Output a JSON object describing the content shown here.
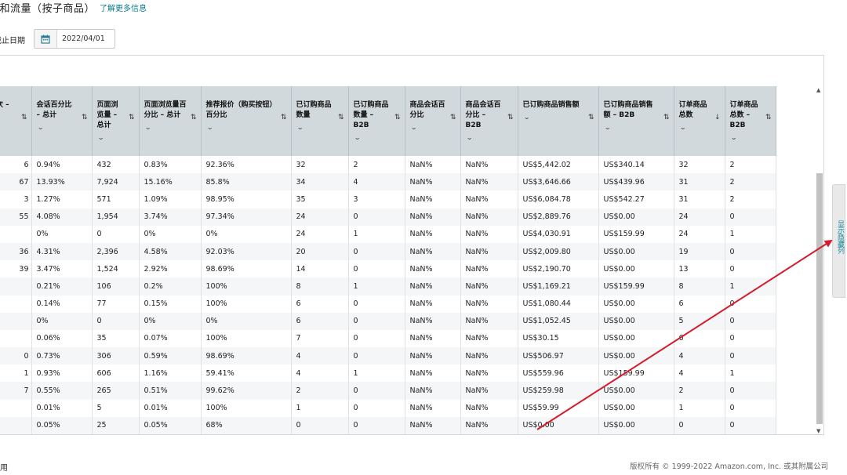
{
  "header": {
    "title": "售和流量（按子商品）",
    "learn_more": "了解更多信息"
  },
  "filter": {
    "date_label": "截止日期",
    "date_value": "2022/04/01"
  },
  "table": {
    "columns": [
      {
        "label": "话次 – 总",
        "sort": "⇅"
      },
      {
        "label": "会话百分比 – 总计",
        "sort": "⇅"
      },
      {
        "label": "页面浏览量 – 总计",
        "sort": "⇅"
      },
      {
        "label": "页面浏览量百分比 – 总计",
        "sort": "⇅"
      },
      {
        "label": "推荐报价（购买按钮）百分比",
        "sort": "⇅"
      },
      {
        "label": "已订购商品数量",
        "sort": "⇅"
      },
      {
        "label": "已订购商品数量 – B2B",
        "sort": "⇅"
      },
      {
        "label": "商品会话百分比",
        "sort": "⇅"
      },
      {
        "label": "商品会话百分比 – B2B",
        "sort": "⇅"
      },
      {
        "label": "已订购商品销售额",
        "sort": "⇅"
      },
      {
        "label": "已订购商品销售额 – B2B",
        "sort": "⇅"
      },
      {
        "label": "订单商品总数",
        "sort": "↓"
      },
      {
        "label": "订单商品总数 – B2B",
        "sort": "⇅"
      }
    ],
    "rows": [
      [
        "6",
        "0.94%",
        "432",
        "0.83%",
        "92.36%",
        "32",
        "2",
        "NaN%",
        "NaN%",
        "US$5,442.02",
        "US$340.14",
        "32",
        "2"
      ],
      [
        "67",
        "13.93%",
        "7,924",
        "15.16%",
        "85.8%",
        "34",
        "4",
        "NaN%",
        "NaN%",
        "US$3,646.66",
        "US$439.96",
        "31",
        "2"
      ],
      [
        "3",
        "1.27%",
        "571",
        "1.09%",
        "98.95%",
        "35",
        "3",
        "NaN%",
        "NaN%",
        "US$6,084.78",
        "US$542.27",
        "31",
        "2"
      ],
      [
        "55",
        "4.08%",
        "1,954",
        "3.74%",
        "97.34%",
        "24",
        "0",
        "NaN%",
        "NaN%",
        "US$2,889.76",
        "US$0.00",
        "24",
        "0"
      ],
      [
        "",
        "0%",
        "0",
        "0%",
        "0%",
        "24",
        "1",
        "NaN%",
        "NaN%",
        "US$4,030.91",
        "US$159.99",
        "24",
        "1"
      ],
      [
        "36",
        "4.31%",
        "2,396",
        "4.58%",
        "92.03%",
        "20",
        "0",
        "NaN%",
        "NaN%",
        "US$2,009.80",
        "US$0.00",
        "19",
        "0"
      ],
      [
        "39",
        "3.47%",
        "1,524",
        "2.92%",
        "98.69%",
        "14",
        "0",
        "NaN%",
        "NaN%",
        "US$2,190.70",
        "US$0.00",
        "13",
        "0"
      ],
      [
        "",
        "0.21%",
        "106",
        "0.2%",
        "100%",
        "8",
        "1",
        "NaN%",
        "NaN%",
        "US$1,169.21",
        "US$159.99",
        "8",
        "1"
      ],
      [
        "",
        "0.14%",
        "77",
        "0.15%",
        "100%",
        "6",
        "0",
        "NaN%",
        "NaN%",
        "US$1,080.44",
        "US$0.00",
        "6",
        "0"
      ],
      [
        "",
        "0%",
        "0",
        "0%",
        "0%",
        "6",
        "0",
        "NaN%",
        "NaN%",
        "US$1,052.45",
        "US$0.00",
        "5",
        "0"
      ],
      [
        "",
        "0.06%",
        "35",
        "0.07%",
        "100%",
        "7",
        "0",
        "NaN%",
        "NaN%",
        "US$30.15",
        "US$0.00",
        "6",
        "0"
      ],
      [
        "0",
        "0.73%",
        "306",
        "0.59%",
        "98.69%",
        "4",
        "0",
        "NaN%",
        "NaN%",
        "US$506.97",
        "US$0.00",
        "4",
        "0"
      ],
      [
        "1",
        "0.93%",
        "606",
        "1.16%",
        "59.41%",
        "4",
        "1",
        "NaN%",
        "NaN%",
        "US$559.96",
        "US$159.99",
        "4",
        "1"
      ],
      [
        "7",
        "0.55%",
        "265",
        "0.51%",
        "99.62%",
        "2",
        "0",
        "NaN%",
        "NaN%",
        "US$259.98",
        "US$0.00",
        "2",
        "0"
      ],
      [
        "",
        "0.01%",
        "5",
        "0.01%",
        "100%",
        "1",
        "0",
        "NaN%",
        "NaN%",
        "US$59.99",
        "US$0.00",
        "1",
        "0"
      ],
      [
        "",
        "0.05%",
        "25",
        "0.05%",
        "68%",
        "0",
        "0",
        "NaN%",
        "NaN%",
        "US$0.00",
        "US$0.00",
        "0",
        "0"
      ]
    ]
  },
  "side_tab": {
    "label": "显示/隐藏列"
  },
  "footer": {
    "left": "使用",
    "right": "版权所有 © 1999-2022 Amazon.com, Inc. 或其附属公司"
  },
  "annotation": {
    "color": "#d41c2c"
  }
}
